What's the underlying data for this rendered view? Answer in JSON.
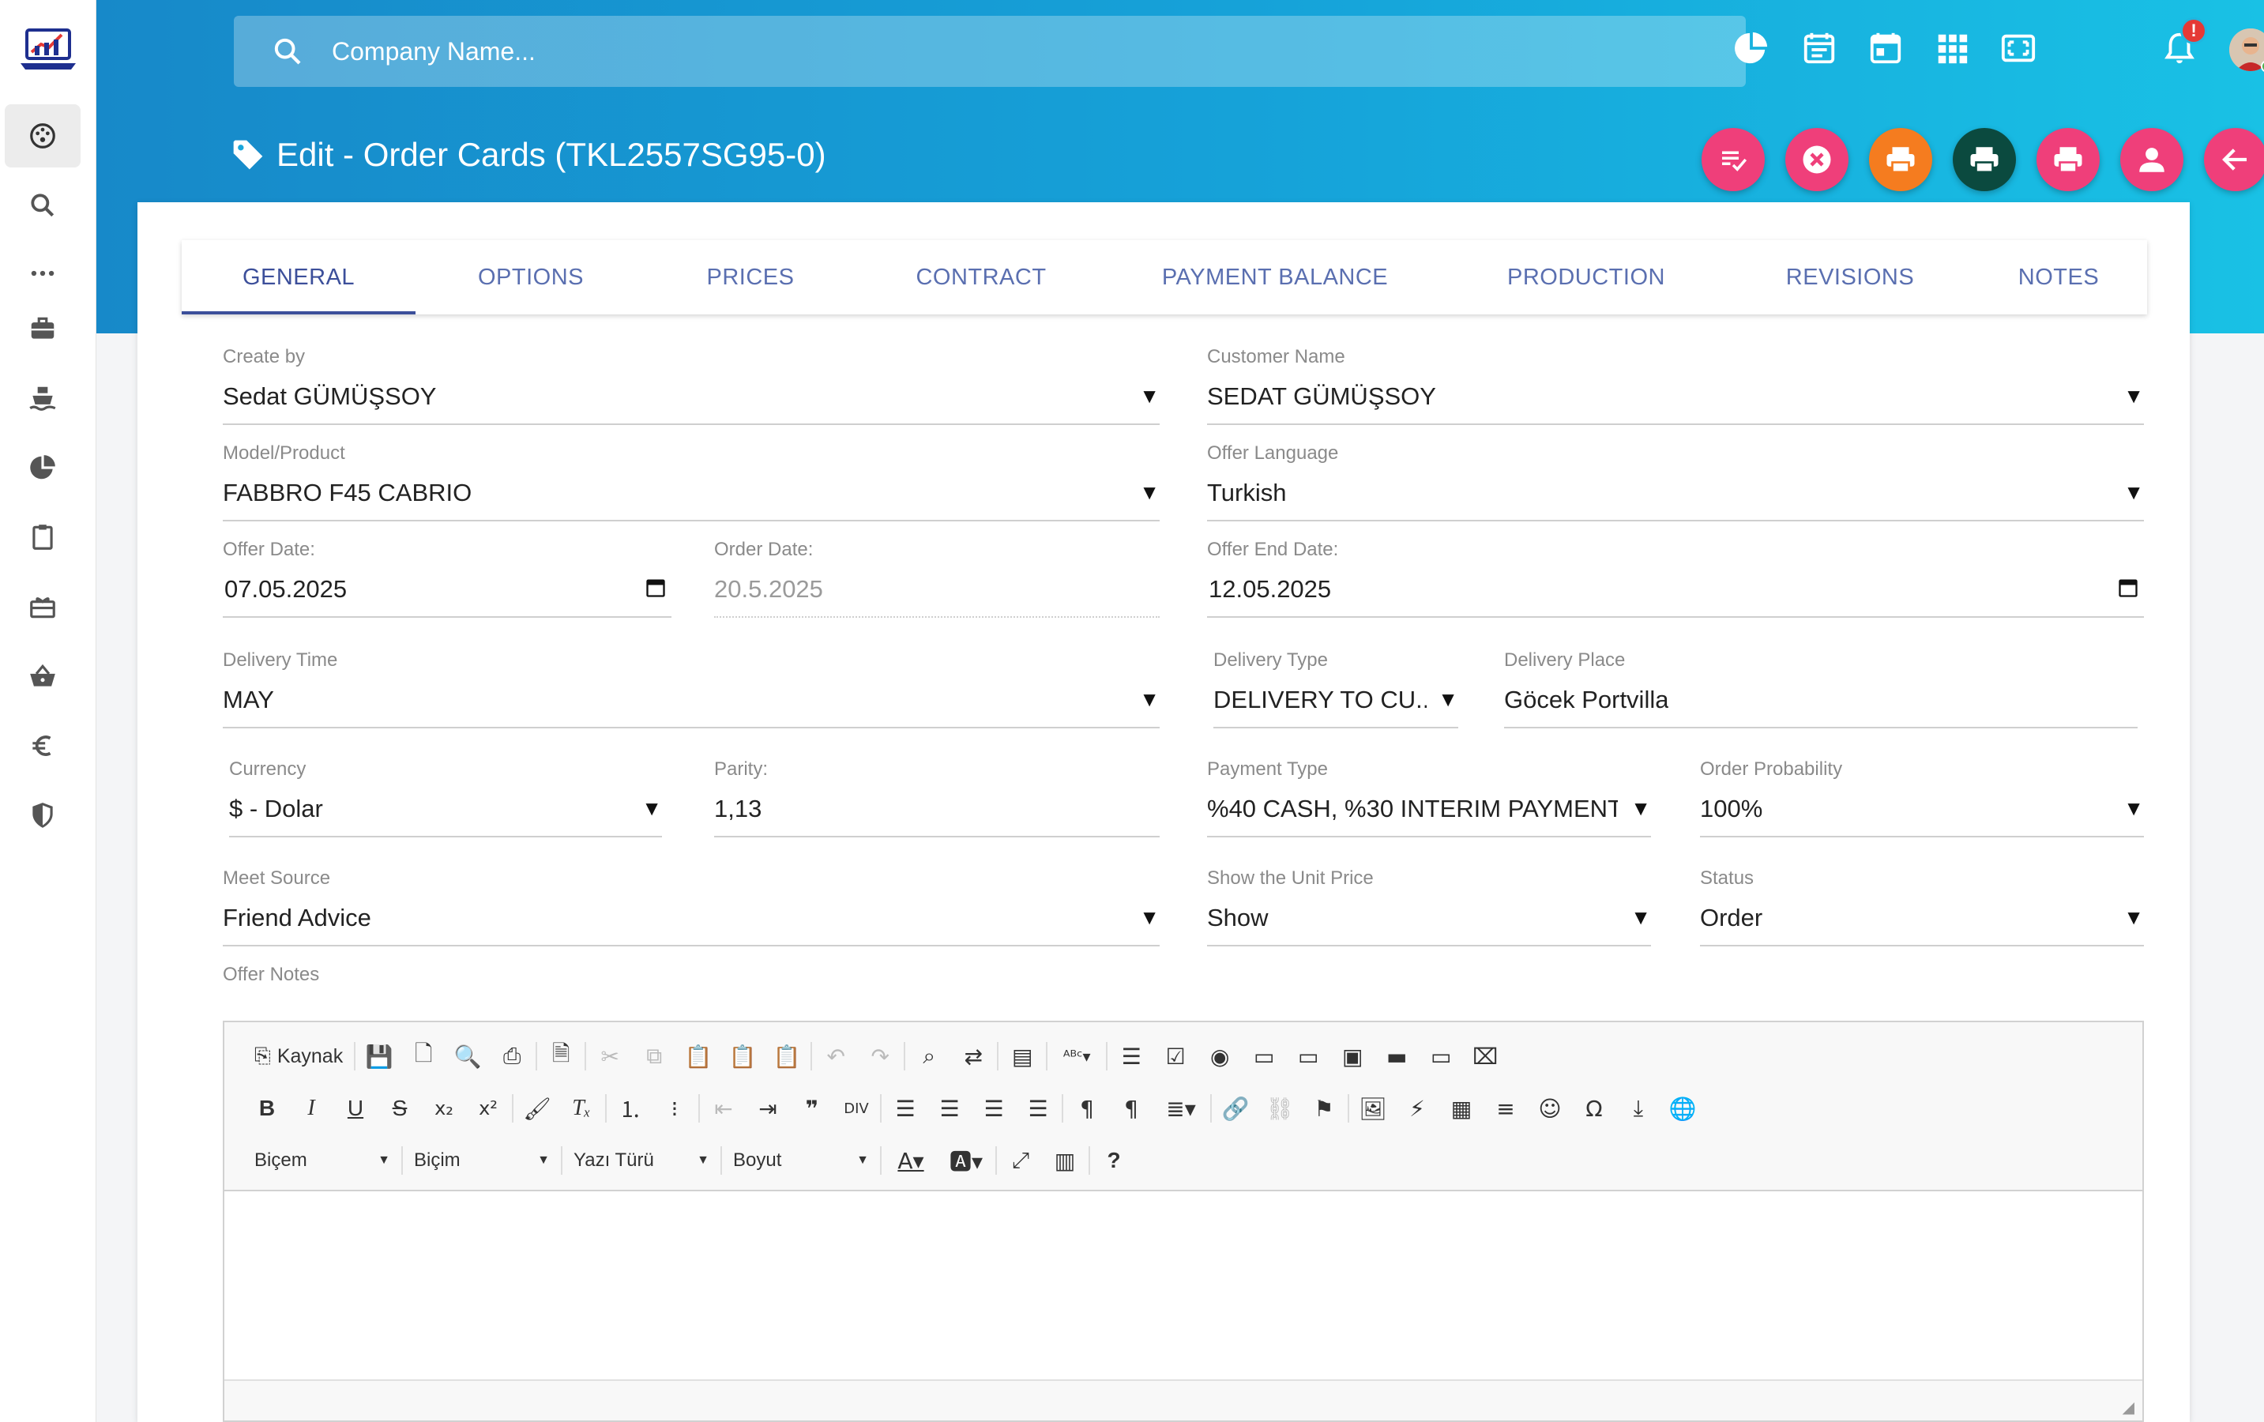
{
  "search": {
    "placeholder": "Company Name..."
  },
  "topbar": {
    "notification_badge": "!"
  },
  "page": {
    "title": "Edit - Order Cards (TKL2557SG95-0)"
  },
  "colors": {
    "accent": "#1fa9de",
    "pink": "#ef3f7a",
    "orange": "#f57c1f",
    "dark_green": "#0b4a3f",
    "tab_blue": "#3c4f9a"
  },
  "sidebar": {
    "items": [
      "dashboard-icon",
      "search-icon",
      "more-icon",
      "briefcase-icon",
      "ship-icon",
      "pie-chart-icon",
      "clipboard-icon",
      "gift-icon",
      "basket-icon",
      "euro-icon",
      "shield-icon"
    ]
  },
  "actions": [
    "checklist-icon",
    "cancel-icon",
    "print-icon",
    "print-icon",
    "print-icon",
    "person-icon",
    "back-arrow-icon"
  ],
  "tabs": [
    "GENERAL",
    "OPTIONS",
    "PRICES",
    "CONTRACT",
    "PAYMENT BALANCE",
    "PRODUCTION",
    "REVISIONS",
    "NOTES"
  ],
  "form": {
    "create_by": {
      "label": "Create by",
      "value": "Sedat GÜMÜŞSOY"
    },
    "customer_name": {
      "label": "Customer Name",
      "value": "SEDAT GÜMÜŞSOY"
    },
    "model": {
      "label": "Model/Product",
      "value": "FABBRO F45 CABRIO"
    },
    "offer_language": {
      "label": "Offer Language",
      "value": "Turkish"
    },
    "offer_date": {
      "label": "Offer Date:",
      "value": "07.05.2025"
    },
    "order_date": {
      "label": "Order Date:",
      "value": "20.5.2025"
    },
    "offer_end_date": {
      "label": "Offer End Date:",
      "value": "12.05.2025"
    },
    "delivery_time": {
      "label": "Delivery Time",
      "value": "MAY"
    },
    "delivery_type": {
      "label": "Delivery Type",
      "value": "DELIVERY TO CU..."
    },
    "delivery_place": {
      "label": "Delivery Place",
      "value": "Göcek Portvilla"
    },
    "currency": {
      "label": "Currency",
      "value": "$ - Dolar"
    },
    "parity": {
      "label": "Parity:",
      "value": "1,13"
    },
    "payment_type": {
      "label": "Payment Type",
      "value": "%40 CASH, %30 INTERIM PAYMENT..."
    },
    "order_probability": {
      "label": "Order Probability",
      "value": "100%"
    },
    "meet_source": {
      "label": "Meet Source",
      "value": "Friend Advice"
    },
    "show_unit_price": {
      "label": "Show the Unit Price",
      "value": "Show"
    },
    "status": {
      "label": "Status",
      "value": "Order"
    },
    "offer_notes": {
      "label": "Offer Notes"
    }
  },
  "editor": {
    "source_label": "Kaynak",
    "style_combo": "Biçem",
    "format_combo": "Biçim",
    "font_combo": "Yazı Türü",
    "size_combo": "Boyut",
    "help": "?"
  }
}
